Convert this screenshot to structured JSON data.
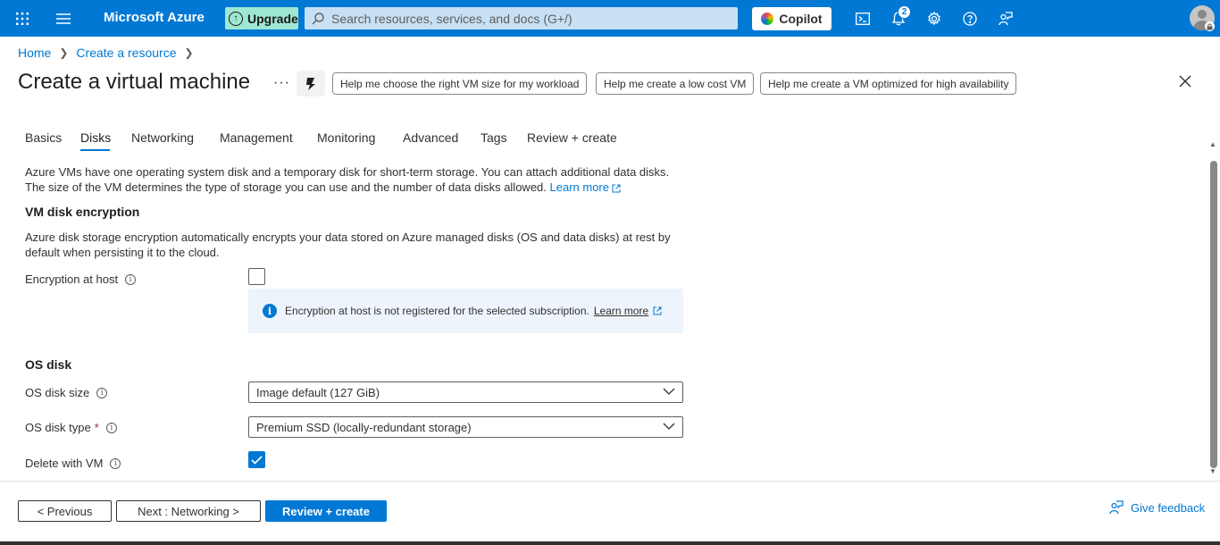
{
  "topbar": {
    "brand": "Microsoft Azure",
    "upgrade_label": "Upgrade",
    "search_placeholder": "Search resources, services, and docs (G+/)",
    "copilot_label": "Copilot",
    "notification_count": "2"
  },
  "breadcrumb": [
    "Home",
    "Create a resource"
  ],
  "page": {
    "title": "Create a virtual machine",
    "more": "···",
    "suggestions": [
      "Help me choose the right VM size for my workload",
      "Help me create a low cost VM",
      "Help me create a VM optimized for high availability"
    ]
  },
  "tabs": [
    "Basics",
    "Disks",
    "Networking",
    "Management",
    "Monitoring",
    "Advanced",
    "Tags",
    "Review + create"
  ],
  "active_tab": "Disks",
  "disks": {
    "intro_line1": "Azure VMs have one operating system disk and a temporary disk for short-term storage. You can attach additional data disks.",
    "intro_line2": "The size of the VM determines the type of storage you can use and the number of data disks allowed.",
    "learn_more": "Learn more",
    "encryption_heading": "VM disk encryption",
    "encryption_desc_line1": "Azure disk storage encryption automatically encrypts your data stored on Azure managed disks (OS and data disks) at rest by",
    "encryption_desc_line2": "default when persisting it to the cloud.",
    "encryption_at_host_label": "Encryption at host",
    "encryption_at_host_checked": false,
    "encryption_info": "Encryption at host is not registered for the selected subscription.",
    "encryption_info_link": "Learn more",
    "os_disk_heading": "OS disk",
    "os_disk_size_label": "OS disk size",
    "os_disk_size_value": "Image default (127 GiB)",
    "os_disk_type_label": "OS disk type",
    "os_disk_type_required": "*",
    "os_disk_type_value": "Premium SSD (locally-redundant storage)",
    "delete_with_vm_label": "Delete with VM",
    "delete_with_vm_checked": true
  },
  "footer": {
    "previous": "< Previous",
    "next": "Next : Networking >",
    "review": "Review + create",
    "feedback": "Give feedback"
  },
  "colors": {
    "accent": "#0078d4",
    "upgrade_bg": "#9ee7d3",
    "info_bg": "#eef4fb"
  }
}
